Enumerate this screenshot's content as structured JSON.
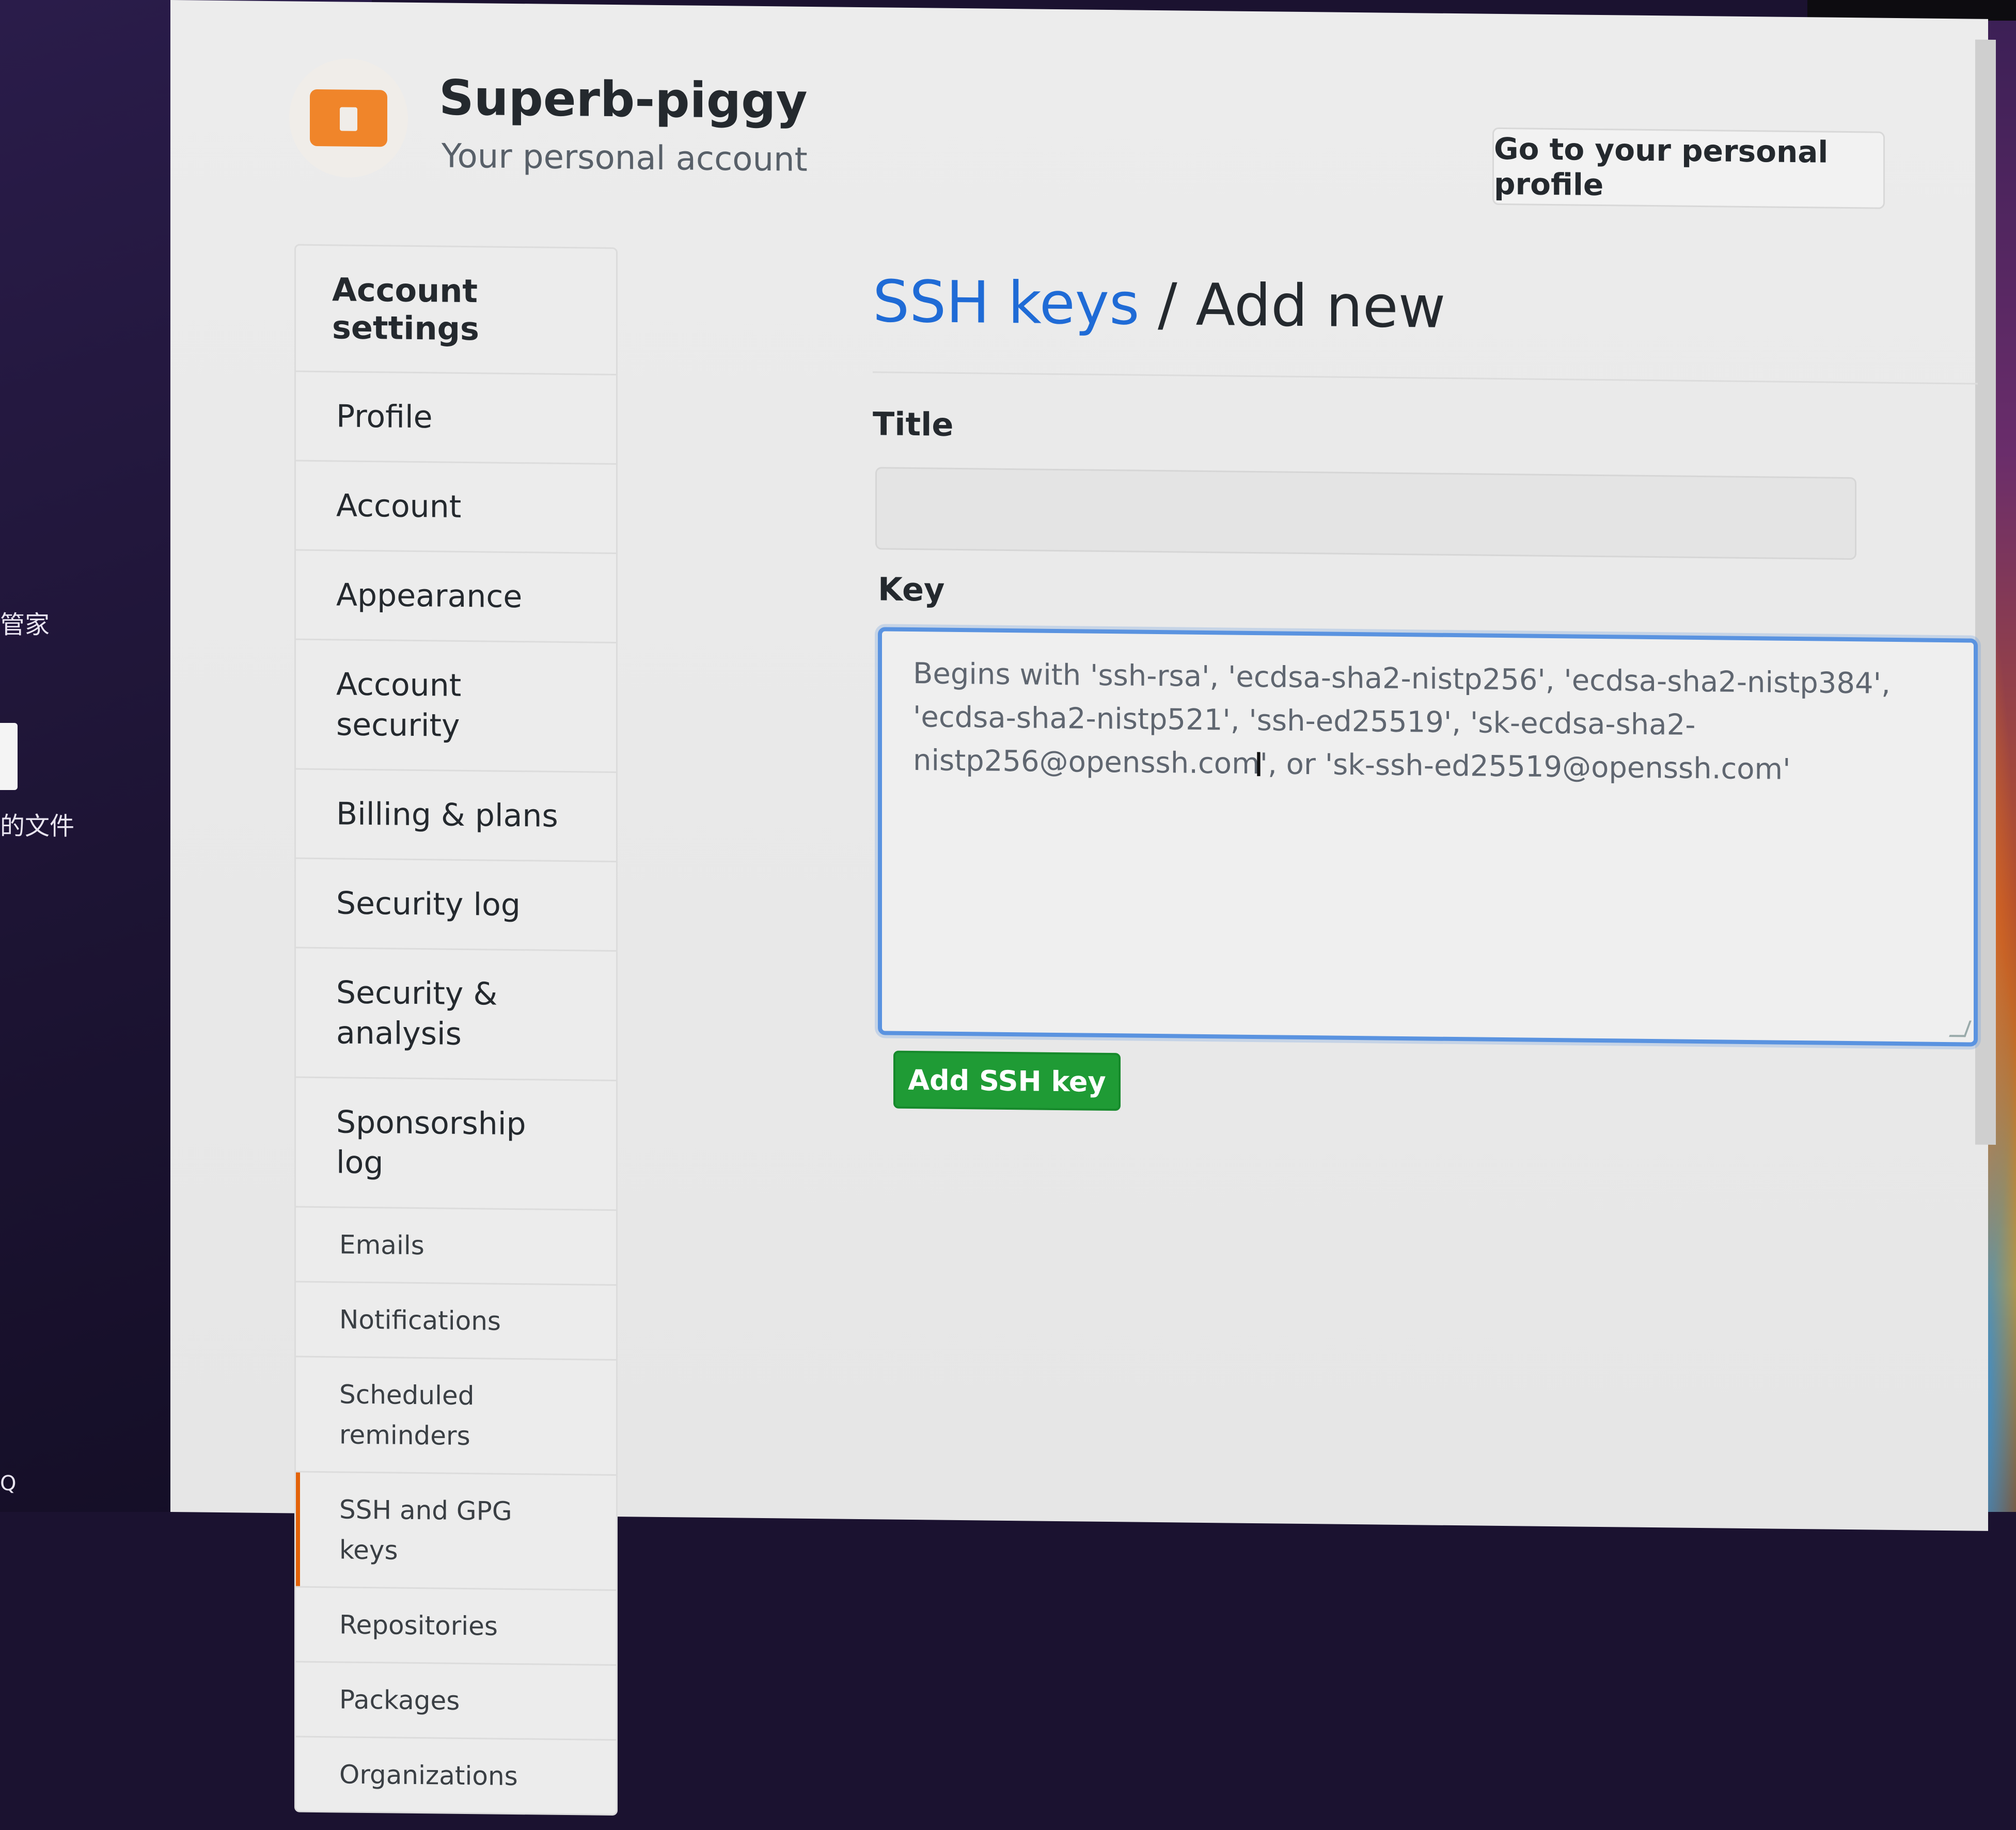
{
  "desktop": {
    "label_1": "管家",
    "label_2": "的文件",
    "label_3": "Q"
  },
  "header": {
    "org_name": "Superb-piggy",
    "org_subtitle": "Your personal account",
    "profile_button": "Go to your personal profile"
  },
  "sidebar": {
    "header": "Account settings",
    "items": [
      {
        "label": "Profile"
      },
      {
        "label": "Account"
      },
      {
        "label": "Appearance"
      },
      {
        "label": "Account security"
      },
      {
        "label": "Billing & plans"
      },
      {
        "label": "Security log"
      },
      {
        "label": "Security & analysis"
      },
      {
        "label": "Sponsorship log"
      },
      {
        "label": "Emails"
      },
      {
        "label": "Notifications"
      },
      {
        "label": "Scheduled reminders"
      },
      {
        "label": "SSH and GPG keys",
        "active": true
      },
      {
        "label": "Repositories"
      },
      {
        "label": "Packages"
      },
      {
        "label": "Organizations"
      }
    ]
  },
  "main": {
    "breadcrumb_link": "SSH keys",
    "breadcrumb_sep": " / ",
    "breadcrumb_current": "Add new",
    "title_label": "Title",
    "title_value": "",
    "key_label": "Key",
    "key_placeholder": "Begins with 'ssh-rsa', 'ecdsa-sha2-nistp256', 'ecdsa-sha2-nistp384', 'ecdsa-sha2-nistp521', 'ssh-ed25519', 'sk-ecdsa-sha2-nistp256@openssh.com', or 'sk-ssh-ed25519@openssh.com'",
    "submit_button": "Add SSH key"
  },
  "colors": {
    "link": "#1f6bd6",
    "primary_button": "#1f9b35",
    "focus_border": "#5a93e0",
    "active_marker": "#e36209",
    "logo": "#f0852a"
  }
}
